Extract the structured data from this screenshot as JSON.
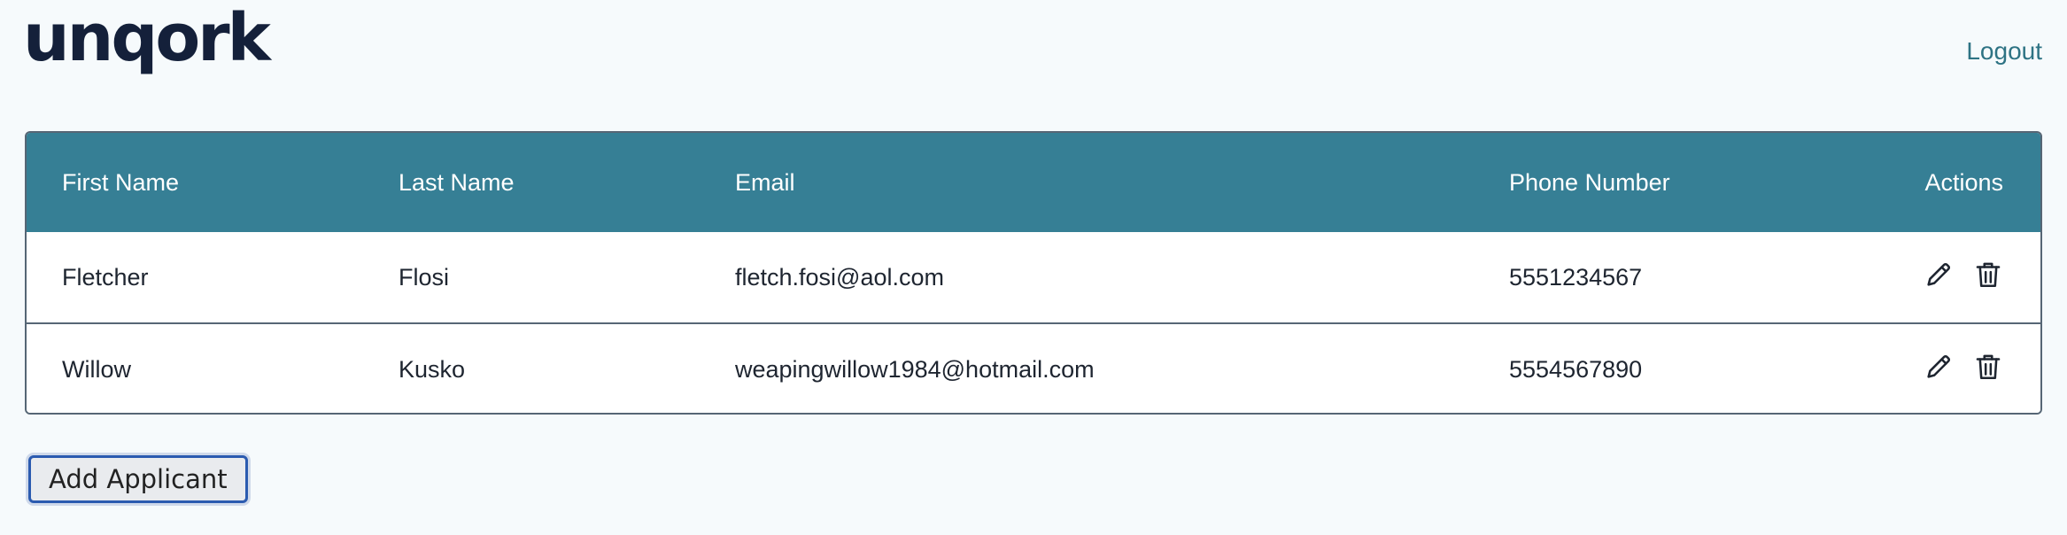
{
  "header": {
    "logo_text": "unqork",
    "logout_label": "Logout"
  },
  "table": {
    "columns": [
      "First Name",
      "Last Name",
      "Email",
      "Phone Number",
      "Actions"
    ],
    "rows": [
      {
        "first_name": "Fletcher",
        "last_name": "Flosi",
        "email": "fletch.fosi@aol.com",
        "phone": "5551234567"
      },
      {
        "first_name": "Willow",
        "last_name": "Kusko",
        "email": "weapingwillow1984@hotmail.com",
        "phone": "5554567890"
      }
    ],
    "row_actions": [
      "pencil-icon",
      "trash-icon"
    ]
  },
  "actions": {
    "add_applicant_label": "Add Applicant"
  },
  "colors": {
    "header_bg": "#367f95",
    "page_bg": "#f6fafc",
    "logo": "#14203a",
    "link": "#2e7384",
    "button_border": "#2b5bb0"
  }
}
